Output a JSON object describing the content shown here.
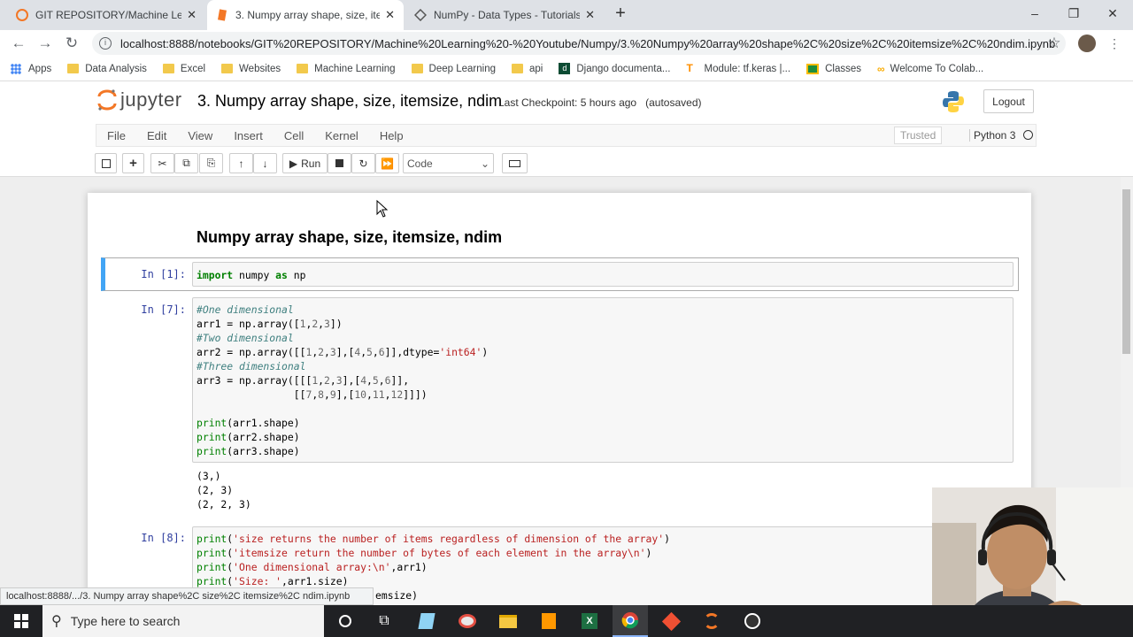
{
  "browser": {
    "tabs": [
      {
        "title": "GIT REPOSITORY/Machine Learni",
        "active": false
      },
      {
        "title": "3. Numpy array shape, size, itemsiz",
        "active": true
      },
      {
        "title": "NumPy - Data Types - Tutorialsp",
        "active": false
      }
    ],
    "new_tab": "+",
    "window_controls": {
      "minimize": "–",
      "restore": "❐",
      "close": "✕"
    },
    "url": "localhost:8888/notebooks/GIT%20REPOSITORY/Machine%20Learning%20-%20Youtube/Numpy/3.%20Numpy%20array%20shape%2C%20size%2C%20itemsize%2C%20ndim.ipynb",
    "bookmarks": [
      "Apps",
      "Data Analysis",
      "Excel",
      "Websites",
      "Machine Learning",
      "Deep Learning",
      "api",
      "Django documenta...",
      "Module: tf.keras |...",
      "Classes",
      "Welcome To Colab..."
    ],
    "status_link": "localhost:8888/.../3. Numpy array shape%2C size%2C itemsize%2C ndim.ipynb"
  },
  "jupyter": {
    "logo_text": "jupyter",
    "notebook_title": "3. Numpy array shape, size, itemsize, ndim",
    "checkpoint": "Last Checkpoint: 5 hours ago",
    "autosave": "(autosaved)",
    "logout": "Logout",
    "menu": [
      "File",
      "Edit",
      "View",
      "Insert",
      "Cell",
      "Kernel",
      "Help"
    ],
    "trusted": "Trusted",
    "kernel": "Python 3",
    "run_label": "Run",
    "cell_type": "Code"
  },
  "notebook": {
    "heading": "Numpy array shape, size, itemsize, ndim",
    "cell1": {
      "prompt": "In [1]:",
      "kw_import": "import",
      "mod": " numpy ",
      "kw_as": "as",
      "alias": " np"
    },
    "cell2": {
      "prompt": "In [7]:",
      "comment1": "#One dimensional",
      "comment2": "#Two dimensional",
      "comment3": "#Three dimensional",
      "dtype_str": "'int64'",
      "outputs": [
        "(3,)",
        "(2, 3)",
        "(2, 2, 3)"
      ]
    },
    "cell3": {
      "prompt": "In [8]:",
      "str1": "'size returns the number of items regardless of dimension of the array'",
      "str2": "'itemsize return the number of bytes of each element in the array\\n'",
      "str3": "'One dimensional array:\\n'",
      "str4": "'Size: '",
      "partial": "emsize)"
    }
  },
  "taskbar": {
    "search_placeholder": "Type here to search"
  },
  "colors": {
    "jupyter_orange": "#f37726",
    "selected_cell_border": "#42a5f5",
    "prompt_blue": "#303f9f",
    "keyword_green": "#008000",
    "comment_teal": "#408080",
    "string_red": "#ba2121"
  }
}
